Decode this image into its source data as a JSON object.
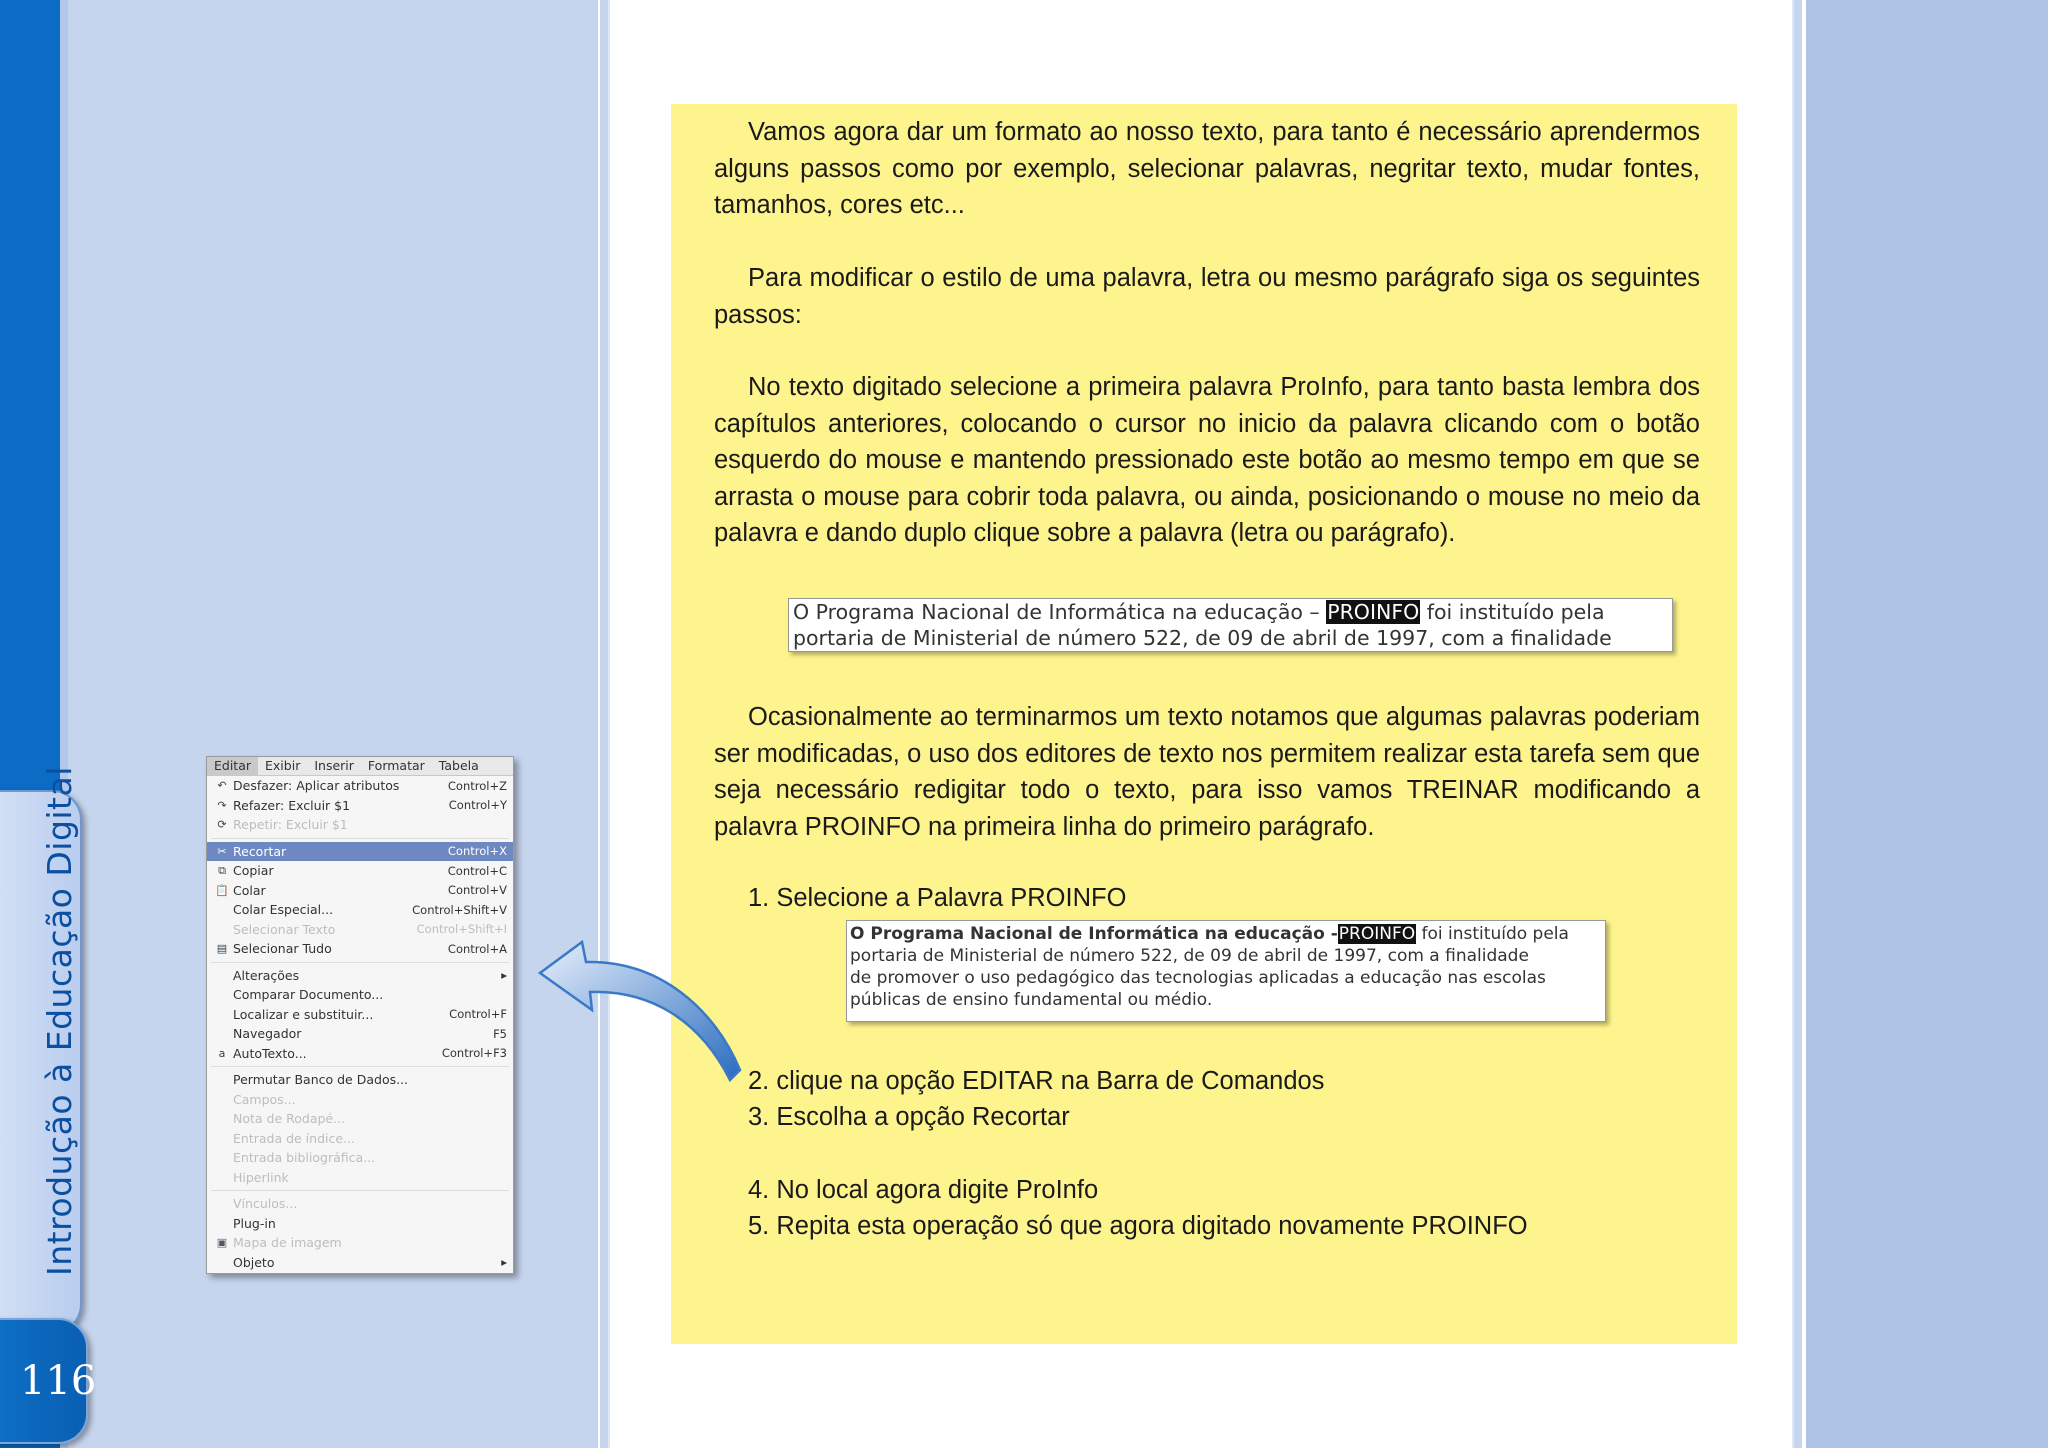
{
  "side": {
    "title": "Introdução à Educação Digital",
    "page_number": "116"
  },
  "paragraphs": {
    "p1": "Vamos agora dar um formato ao nosso texto, para tanto é necessário aprendermos alguns passos como por exemplo, selecionar palavras, negritar texto, mudar fontes, tamanhos, cores etc...",
    "p2": "Para modificar o estilo de uma palavra, letra ou mesmo parágrafo siga os seguintes passos:",
    "p3": "No texto digitado selecione a primeira palavra ProInfo, para tanto  basta lembra dos capítulos anteriores, colocando o cursor no inicio da palavra clicando com o botão esquerdo do mouse e mantendo pressionado este botão ao mesmo tempo em que se arrasta o mouse para cobrir toda palavra, ou ainda, posicionando o mouse no meio da palavra e dando duplo clique sobre a palavra (letra ou parágrafo).",
    "p4": "Ocasionalmente ao terminarmos um texto notamos que algumas palavras poderiam ser modificadas, o uso dos editores de texto nos permitem realizar esta tarefa sem que seja necessário redigitar todo o texto, para isso vamos TREINAR modificando a palavra PROINFO na primeira linha do primeiro parágrafo."
  },
  "excerpt1": {
    "line1_before": "O Programa Nacional de Informática na educação – ",
    "highlight": "PROINFO",
    "line1_after": " foi instituído pela",
    "line2": "portaria de Ministerial de número 522, de 09 de abril de 1997, com a finalidade"
  },
  "excerpt2": {
    "line1_before": "O Programa Nacional de Informática na educação -",
    "highlight": "PROINFO",
    "line1_after": " foi instituído pela",
    "line2": "portaria de Ministerial de número 522, de 09 de abril de 1997, com a finalidade",
    "line3": "de promover o uso pedagógico das tecnologias aplicadas a educação nas escolas",
    "line4": "públicas de ensino fundamental ou médio."
  },
  "steps": [
    "1. Selecione a Palavra PROINFO",
    "2. clique na opção EDITAR na Barra de Comandos",
    "3. Escolha a opção Recortar",
    "4. No local agora digite ProInfo",
    "5. Repita esta operação só que agora digitado novamente PROINFO"
  ],
  "menu": {
    "bar": [
      "Editar",
      "Exibir",
      "Inserir",
      "Formatar",
      "Tabela"
    ],
    "items": [
      {
        "label": "Desfazer: Aplicar atributos",
        "shortcut": "Control+Z",
        "icon": "↶"
      },
      {
        "label": "Refazer: Excluir $1",
        "shortcut": "Control+Y",
        "icon": "↷"
      },
      {
        "label": "Repetir: Excluir $1",
        "shortcut": "",
        "icon": "⟳"
      },
      {
        "label": "Recortar",
        "shortcut": "Control+X",
        "icon": "✂"
      },
      {
        "label": "Copiar",
        "shortcut": "Control+C",
        "icon": "⧉"
      },
      {
        "label": "Colar",
        "shortcut": "Control+V",
        "icon": "📋"
      },
      {
        "label": "Colar Especial...",
        "shortcut": "Control+Shift+V",
        "icon": ""
      },
      {
        "label": "Selecionar Texto",
        "shortcut": "Control+Shift+I",
        "icon": ""
      },
      {
        "label": "Selecionar Tudo",
        "shortcut": "Control+A",
        "icon": "▤"
      },
      {
        "label": "Alterações",
        "shortcut": "▸",
        "icon": ""
      },
      {
        "label": "Comparar Documento...",
        "shortcut": "",
        "icon": ""
      },
      {
        "label": "Localizar e substituir...",
        "shortcut": "Control+F",
        "icon": ""
      },
      {
        "label": "Navegador",
        "shortcut": "F5",
        "icon": ""
      },
      {
        "label": "AutoTexto...",
        "shortcut": "Control+F3",
        "icon": "a"
      },
      {
        "label": "Permutar Banco de Dados...",
        "shortcut": "",
        "icon": ""
      },
      {
        "label": "Campos...",
        "shortcut": "",
        "icon": ""
      },
      {
        "label": "Nota de Rodapé...",
        "shortcut": "",
        "icon": ""
      },
      {
        "label": "Entrada de índice...",
        "shortcut": "",
        "icon": ""
      },
      {
        "label": "Entrada bibliográfica...",
        "shortcut": "",
        "icon": ""
      },
      {
        "label": "Hiperlink",
        "shortcut": "",
        "icon": ""
      },
      {
        "label": "Vínculos...",
        "shortcut": "",
        "icon": ""
      },
      {
        "label": "Plug-in",
        "shortcut": "",
        "icon": ""
      },
      {
        "label": "Mapa de imagem",
        "shortcut": "",
        "icon": "▣"
      },
      {
        "label": "Objeto",
        "shortcut": "▸",
        "icon": ""
      }
    ]
  }
}
